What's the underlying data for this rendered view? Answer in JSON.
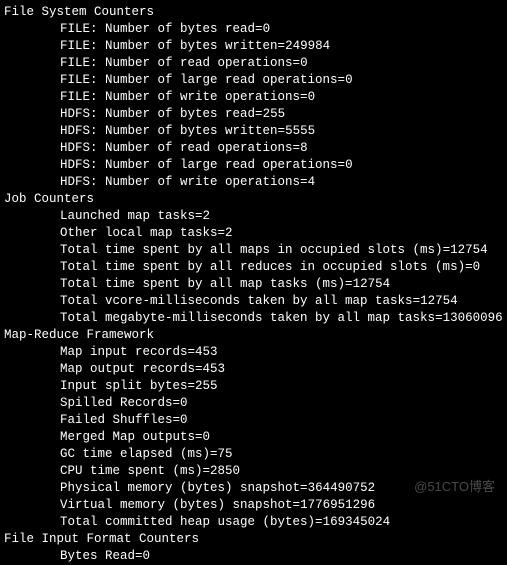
{
  "sections": [
    {
      "title": "File System Counters",
      "counters": [
        {
          "label": "FILE: Number of bytes read",
          "value": 0
        },
        {
          "label": "FILE: Number of bytes written",
          "value": 249984
        },
        {
          "label": "FILE: Number of read operations",
          "value": 0
        },
        {
          "label": "FILE: Number of large read operations",
          "value": 0
        },
        {
          "label": "FILE: Number of write operations",
          "value": 0
        },
        {
          "label": "HDFS: Number of bytes read",
          "value": 255
        },
        {
          "label": "HDFS: Number of bytes written",
          "value": 5555
        },
        {
          "label": "HDFS: Number of read operations",
          "value": 8
        },
        {
          "label": "HDFS: Number of large read operations",
          "value": 0
        },
        {
          "label": "HDFS: Number of write operations",
          "value": 4
        }
      ]
    },
    {
      "title": "Job Counters",
      "counters": [
        {
          "label": "Launched map tasks",
          "value": 2
        },
        {
          "label": "Other local map tasks",
          "value": 2
        },
        {
          "label": "Total time spent by all maps in occupied slots (ms)",
          "value": 12754
        },
        {
          "label": "Total time spent by all reduces in occupied slots (ms)",
          "value": 0
        },
        {
          "label": "Total time spent by all map tasks (ms)",
          "value": 12754
        },
        {
          "label": "Total vcore-milliseconds taken by all map tasks",
          "value": 12754
        },
        {
          "label": "Total megabyte-milliseconds taken by all map tasks",
          "value": 13060096
        }
      ]
    },
    {
      "title": "Map-Reduce Framework",
      "counters": [
        {
          "label": "Map input records",
          "value": 453
        },
        {
          "label": "Map output records",
          "value": 453
        },
        {
          "label": "Input split bytes",
          "value": 255
        },
        {
          "label": "Spilled Records",
          "value": 0
        },
        {
          "label": "Failed Shuffles",
          "value": 0
        },
        {
          "label": "Merged Map outputs",
          "value": 0
        },
        {
          "label": "GC time elapsed (ms)",
          "value": 75
        },
        {
          "label": "CPU time spent (ms)",
          "value": 2850
        },
        {
          "label": "Physical memory (bytes) snapshot",
          "value": 364490752
        },
        {
          "label": "Virtual memory (bytes) snapshot",
          "value": 1776951296
        },
        {
          "label": "Total committed heap usage (bytes)",
          "value": 169345024
        }
      ]
    },
    {
      "title": "File Input Format Counters",
      "counters": [
        {
          "label": "Bytes Read",
          "value": 0
        }
      ]
    }
  ],
  "watermark": "@51CTO博客"
}
